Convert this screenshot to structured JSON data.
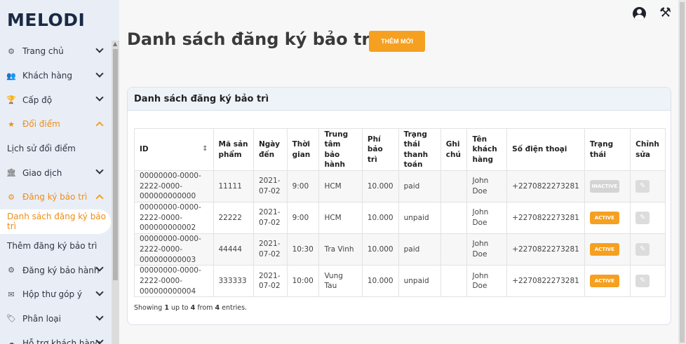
{
  "sidebar": {
    "brand": "MELODI",
    "items": [
      {
        "label": "Trang chủ",
        "icon": "dashboard-icon",
        "glyph": "⚙",
        "chevron": "down"
      },
      {
        "label": "Khách hàng",
        "icon": "users-icon",
        "glyph": "👥",
        "chevron": "down"
      },
      {
        "label": "Cấp độ",
        "icon": "trophy-icon",
        "glyph": "🏆",
        "chevron": "down"
      },
      {
        "label": "Đổi điểm",
        "icon": "star-icon",
        "glyph": "★",
        "chevron": "up"
      },
      {
        "label": "Lịch sử đổi điểm"
      },
      {
        "label": "Giao dịch",
        "icon": "bank-icon",
        "glyph": "🏛",
        "chevron": "down"
      },
      {
        "label": "Đăng ký bảo trì",
        "icon": "cogs-icon",
        "glyph": "⚙",
        "chevron": "up"
      },
      {
        "label": "Danh sách đăng ký bảo trì"
      },
      {
        "label": "Thêm đăng ký bảo trì"
      },
      {
        "label": "Đăng ký bảo hành",
        "icon": "cogs-icon",
        "glyph": "⚙",
        "chevron": "down"
      },
      {
        "label": "Hộp thư góp ý",
        "icon": "mail-icon",
        "glyph": "✉",
        "chevron": "down"
      },
      {
        "label": "Phân loại",
        "icon": "tags-icon",
        "glyph": "🏷",
        "chevron": "down"
      },
      {
        "label": "Hỗ trợ khách hàng",
        "icon": "support-icon",
        "glyph": "☁",
        "chevron": "down"
      }
    ]
  },
  "header": {
    "title": "Danh sách đăng ký bảo trì",
    "add_button": "THÊM MỚI",
    "user_icon": "user-circle-icon",
    "tools_icon": "tools-icon"
  },
  "card": {
    "title": "Danh sách đăng ký bảo trì",
    "columns": [
      "ID",
      "Mã sản phẩm",
      "Ngày đến",
      "Thời gian",
      "Trung tâm bảo hành",
      "Phí bảo trì",
      "Trạng thái thanh toán",
      "Ghi chú",
      "Tên khách hàng",
      "Số điện thoại",
      "Trạng thái",
      "Chỉnh sửa"
    ],
    "rows": [
      {
        "id": "00000000-0000-2222-0000-000000000000",
        "product": "11111",
        "date": "2021-07-02",
        "time": "9:00",
        "center": "HCM",
        "fee": "10.000",
        "payment": "paid",
        "note": "",
        "customer": "John Doe",
        "phone": "+2270822273281",
        "status": "INACTIVE"
      },
      {
        "id": "00000000-0000-2222-0000-000000000002",
        "product": "22222",
        "date": "2021-07-02",
        "time": "9:00",
        "center": "HCM",
        "fee": "10.000",
        "payment": "unpaid",
        "note": "",
        "customer": "John Doe",
        "phone": "+2270822273281",
        "status": "ACTIVE"
      },
      {
        "id": "00000000-0000-2222-0000-000000000003",
        "product": "44444",
        "date": "2021-07-02",
        "time": "10:30",
        "center": "Tra Vinh",
        "fee": "10.000",
        "payment": "paid",
        "note": "",
        "customer": "John Doe",
        "phone": "+2270822273281",
        "status": "ACTIVE"
      },
      {
        "id": "00000000-0000-2222-0000-000000000004",
        "product": "333333",
        "date": "2021-07-02",
        "time": "10:00",
        "center": "Vung Tau",
        "fee": "10.000",
        "payment": "unpaid",
        "note": "",
        "customer": "John Doe",
        "phone": "+2270822273281",
        "status": "ACTIVE"
      }
    ],
    "footer": {
      "prefix": "Showing",
      "from": "1",
      "mid1": "up to",
      "to": "4",
      "mid2": "from",
      "total": "4",
      "suffix": "entries."
    }
  },
  "colors": {
    "accent": "#f5a020",
    "inactive": "#d4d4d4",
    "sidebar_bg": "#e9eef6"
  }
}
